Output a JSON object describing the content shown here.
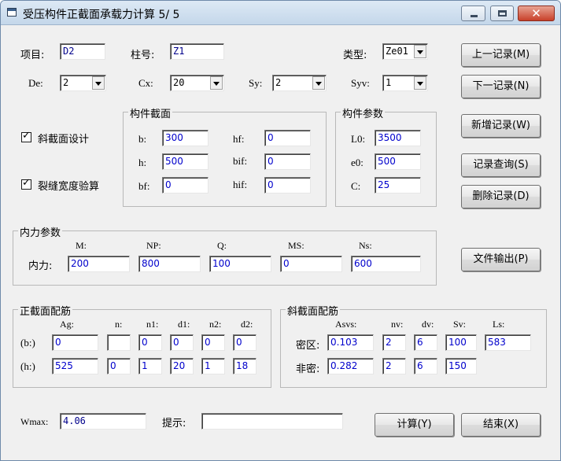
{
  "window": {
    "title": "受压构件正截面承载力计算 5/ 5",
    "close_glyph": "✕"
  },
  "record": {
    "project_label": "项目:",
    "project_value": "D2",
    "column_label": "柱号:",
    "column_value": "Z1",
    "type_label": "类型:",
    "type_value": "Ze01",
    "de_label": "De:",
    "de_value": "2",
    "cx_label": "Cx:",
    "cx_value": "20",
    "sy_label": "Sy:",
    "sy_value": "2",
    "syv_label": "Syv:",
    "syv_value": "1"
  },
  "checkboxes": {
    "oblique_design": {
      "label": "斜截面设计",
      "checked": true
    },
    "crack_width": {
      "label": "裂缝宽度验算",
      "checked": true
    }
  },
  "section": {
    "title": "构件截面",
    "b_label": "b:",
    "b_value": "300",
    "h_label": "h:",
    "h_value": "500",
    "bf_label": "bf:",
    "bf_value": "0",
    "hf_label": "hf:",
    "hf_value": "0",
    "bif_label": "bif:",
    "bif_value": "0",
    "hif_label": "hif:",
    "hif_value": "0"
  },
  "params": {
    "title": "构件参数",
    "l0_label": "L0:",
    "l0_value": "3500",
    "e0_label": "e0:",
    "e0_value": "500",
    "c_label": "C:",
    "c_value": "25"
  },
  "forces": {
    "title": "内力参数",
    "row_label": "内力:",
    "headers": [
      "M:",
      "NP:",
      "Q:",
      "MS:",
      "Ns:"
    ],
    "values": [
      "200",
      "800",
      "100",
      "0",
      "600"
    ]
  },
  "normal_rebar": {
    "title": "正截面配筋",
    "headers": [
      "Ag:",
      "n:",
      "n1:",
      "d1:",
      "n2:",
      "d2:"
    ],
    "rows": [
      {
        "label": "(b:)",
        "values": [
          "0",
          "",
          "0",
          "0",
          "0",
          "0"
        ]
      },
      {
        "label": "(h:)",
        "values": [
          "525",
          "0",
          "1",
          "20",
          "1",
          "18"
        ]
      }
    ]
  },
  "oblique_rebar": {
    "title": "斜截面配筋",
    "headers": [
      "Asvs:",
      "nv:",
      "dv:",
      "Sv:",
      "Ls:"
    ],
    "rows": [
      {
        "label": "密区:",
        "values": [
          "0.103",
          "2",
          "6",
          "100",
          "583"
        ]
      },
      {
        "label": "非密:",
        "values": [
          "0.282",
          "2",
          "6",
          "150"
        ]
      }
    ]
  },
  "result": {
    "wmax_label": "Wmax:",
    "wmax_value": "4.06",
    "hint_label": "提示:",
    "hint_value": ""
  },
  "buttons": {
    "prev": "上一记录(M)",
    "next": "下一记录(N)",
    "add": "新增记录(W)",
    "query": "记录查询(S)",
    "delete": "删除记录(D)",
    "export": "文件输出(P)",
    "calc": "计算(Y)",
    "finish": "结束(X)"
  },
  "colors": {
    "value_text": "#00008b",
    "window_bg": "#f0f0f0",
    "title_gradient": "#dde9f5",
    "close_button": "#c8402a"
  }
}
